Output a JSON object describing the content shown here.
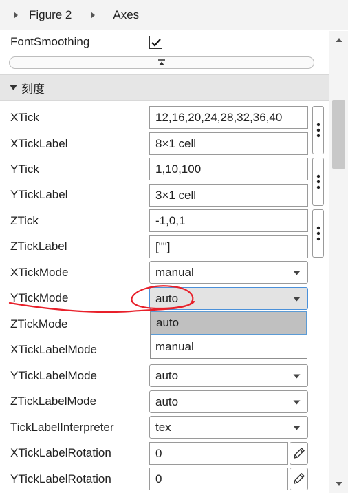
{
  "breadcrumb": {
    "items": [
      "Figure 2",
      "Axes"
    ]
  },
  "props": {
    "font_smoothing": {
      "label": "FontSmoothing",
      "checked": true
    },
    "section": {
      "label": "刻度"
    },
    "xtick": {
      "label": "XTick",
      "value": "12,16,20,24,28,32,36,40"
    },
    "xticklabel": {
      "label": "XTickLabel",
      "value": "8×1 cell"
    },
    "ytick": {
      "label": "YTick",
      "value": "1,10,100"
    },
    "yticklabel": {
      "label": "YTickLabel",
      "value": "3×1 cell"
    },
    "ztick": {
      "label": "ZTick",
      "value": "-1,0,1"
    },
    "zticklabel": {
      "label": "ZTickLabel",
      "value": "[\"\"]"
    },
    "xtickmode": {
      "label": "XTickMode",
      "value": "manual"
    },
    "ytickmode": {
      "label": "YTickMode",
      "value": "auto",
      "options": [
        "auto",
        "manual"
      ]
    },
    "ztickmode": {
      "label": "ZTickMode"
    },
    "xticklabelmode": {
      "label": "XTickLabelMode"
    },
    "yticklabelmode": {
      "label": "YTickLabelMode",
      "value": "auto"
    },
    "zticklabelmode": {
      "label": "ZTickLabelMode",
      "value": "auto"
    },
    "ticklabelinterpreter": {
      "label": "TickLabelInterpreter",
      "value": "tex"
    },
    "xticklabelrotation": {
      "label": "XTickLabelRotation",
      "value": "0"
    },
    "yticklabelrotation": {
      "label": "YTickLabelRotation",
      "value": "0"
    }
  },
  "colors": {
    "annotation": "#e8202a",
    "focus_border": "#4a90d9",
    "section_bg": "#e6e6e6"
  },
  "icons": {
    "breadcrumb_separator": "chevron-right-icon",
    "collapse": "collapse-up-icon",
    "section_toggle": "triangle-down-icon",
    "more": "vertical-ellipsis-icon",
    "dropdown": "caret-down-icon",
    "edit": "pencil-icon"
  }
}
